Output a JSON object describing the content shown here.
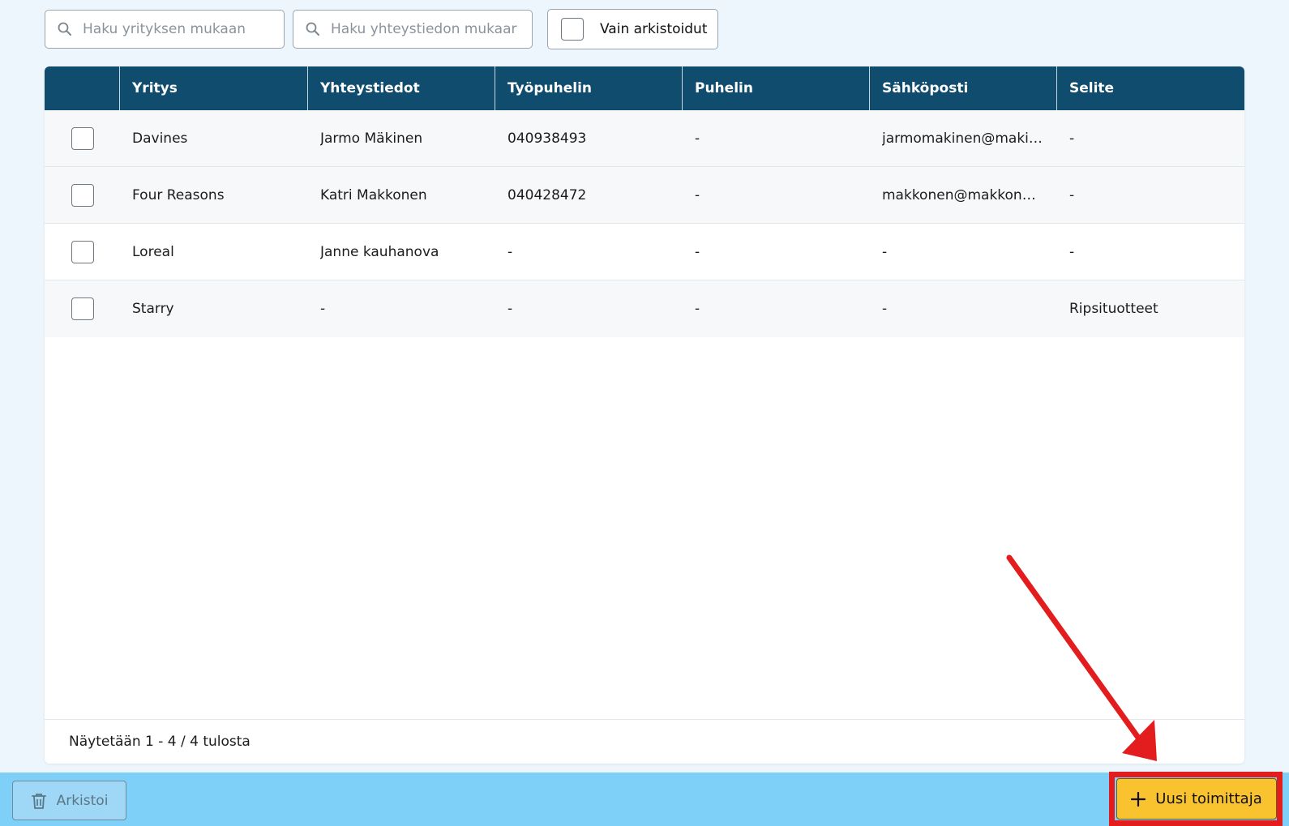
{
  "filters": {
    "company_search_placeholder": "Haku yrityksen mukaan",
    "contact_search_placeholder": "Haku yhteystiedon mukaar",
    "archived_only_label": "Vain arkistoidut"
  },
  "table": {
    "headers": {
      "company": "Yritys",
      "contact": "Yhteystiedot",
      "work_phone": "Työpuhelin",
      "phone": "Puhelin",
      "email": "Sähköposti",
      "description": "Selite"
    },
    "rows": [
      {
        "company": "Davines",
        "contact": "Jarmo Mäkinen",
        "work_phone": "040938493",
        "phone": "-",
        "email": "jarmomakinen@makin...",
        "description": "-"
      },
      {
        "company": "Four Reasons",
        "contact": "Katri Makkonen",
        "work_phone": "040428472",
        "phone": "-",
        "email": "makkonen@makkonen...",
        "description": "-"
      },
      {
        "company": "Loreal",
        "contact": "Janne kauhanova",
        "work_phone": "-",
        "phone": "-",
        "email": "-",
        "description": "-"
      },
      {
        "company": "Starry",
        "contact": "-",
        "work_phone": "-",
        "phone": "-",
        "email": "-",
        "description": "Ripsituotteet"
      }
    ],
    "footer": "Näytetään 1 - 4 / 4 tulosta"
  },
  "actions": {
    "archive_label": "Arkistoi",
    "new_supplier_label": "Uusi toimittaja"
  },
  "icons": {
    "search": "search-icon",
    "trash": "trash-icon",
    "plus": "plus-icon"
  },
  "colors": {
    "header_bg": "#0f4c6e",
    "bottom_bar": "#7fd0f8",
    "primary_button": "#f8c32f",
    "annotation": "#e31d1d"
  }
}
